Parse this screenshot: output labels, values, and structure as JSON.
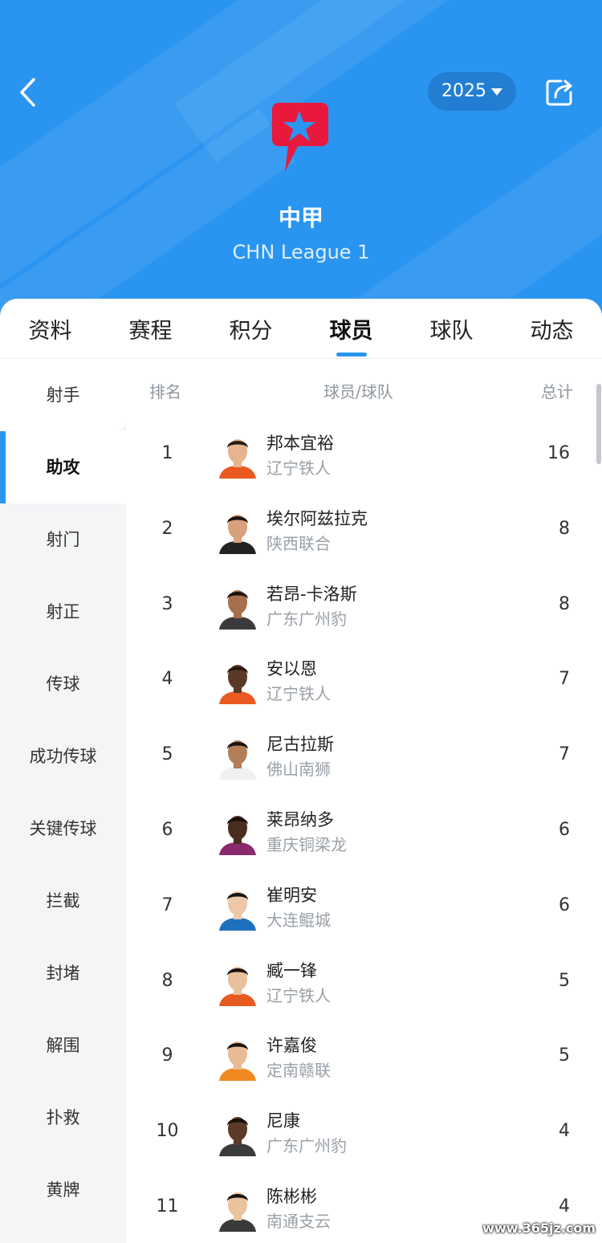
{
  "header": {
    "season": "2025",
    "league_cn": "中甲",
    "league_en": "CHN League 1",
    "accent_color": "#2a95f0",
    "logo_color": "#e8193c"
  },
  "tabs": [
    {
      "label": "资料"
    },
    {
      "label": "赛程"
    },
    {
      "label": "积分"
    },
    {
      "label": "球员",
      "active": true
    },
    {
      "label": "球队"
    },
    {
      "label": "动态"
    }
  ],
  "sidebar": {
    "items": [
      {
        "label": "射手"
      },
      {
        "label": "助攻",
        "active": true
      },
      {
        "label": "射门"
      },
      {
        "label": "射正"
      },
      {
        "label": "传球"
      },
      {
        "label": "成功传球"
      },
      {
        "label": "关键传球"
      },
      {
        "label": "拦截"
      },
      {
        "label": "封堵"
      },
      {
        "label": "解围"
      },
      {
        "label": "扑救"
      },
      {
        "label": "黄牌"
      }
    ]
  },
  "table": {
    "headers": {
      "rank": "排名",
      "player": "球员/球队",
      "total": "总计"
    },
    "rows": [
      {
        "rank": "1",
        "name": "邦本宜裕",
        "team": "辽宁铁人",
        "total": "16",
        "skin": "#e6b48f",
        "hair": "#2a1c14",
        "shirt": "#e85a20"
      },
      {
        "rank": "2",
        "name": "埃尔阿兹拉克",
        "team": "陕西联合",
        "total": "8",
        "skin": "#d9a07c",
        "hair": "#1d1410",
        "shirt": "#222222"
      },
      {
        "rank": "3",
        "name": "若昂-卡洛斯",
        "team": "广东广州豹",
        "total": "8",
        "skin": "#a86f4c",
        "hair": "#1a110c",
        "shirt": "#3b3b3b"
      },
      {
        "rank": "4",
        "name": "安以恩",
        "team": "辽宁铁人",
        "total": "7",
        "skin": "#5a3a26",
        "hair": "#2a1a10",
        "shirt": "#e85a20"
      },
      {
        "rank": "5",
        "name": "尼古拉斯",
        "team": "佛山南狮",
        "total": "7",
        "skin": "#b27e58",
        "hair": "#1a110c",
        "shirt": "#f0f0f0"
      },
      {
        "rank": "6",
        "name": "莱昂纳多",
        "team": "重庆铜梁龙",
        "total": "6",
        "skin": "#4a2d1e",
        "hair": "#1a100a",
        "shirt": "#8a2a6e"
      },
      {
        "rank": "7",
        "name": "崔明安",
        "team": "大连鲲城",
        "total": "6",
        "skin": "#ecc8a8",
        "hair": "#1a1410",
        "shirt": "#1f6fbf"
      },
      {
        "rank": "8",
        "name": "臧一锋",
        "team": "辽宁铁人",
        "total": "5",
        "skin": "#e9c09c",
        "hair": "#1a1410",
        "shirt": "#e85a20"
      },
      {
        "rank": "9",
        "name": "许嘉俊",
        "team": "定南赣联",
        "total": "5",
        "skin": "#e8bb94",
        "hair": "#1a1410",
        "shirt": "#f08a20"
      },
      {
        "rank": "10",
        "name": "尼康",
        "team": "广东广州豹",
        "total": "4",
        "skin": "#5b3a28",
        "hair": "#1a100a",
        "shirt": "#3b3b3b"
      },
      {
        "rank": "11",
        "name": "陈彬彬",
        "team": "南通支云",
        "total": "4",
        "skin": "#e9c29e",
        "hair": "#1a1410",
        "shirt": "#3a3a3a"
      }
    ]
  },
  "watermark": "www.365jz.com"
}
